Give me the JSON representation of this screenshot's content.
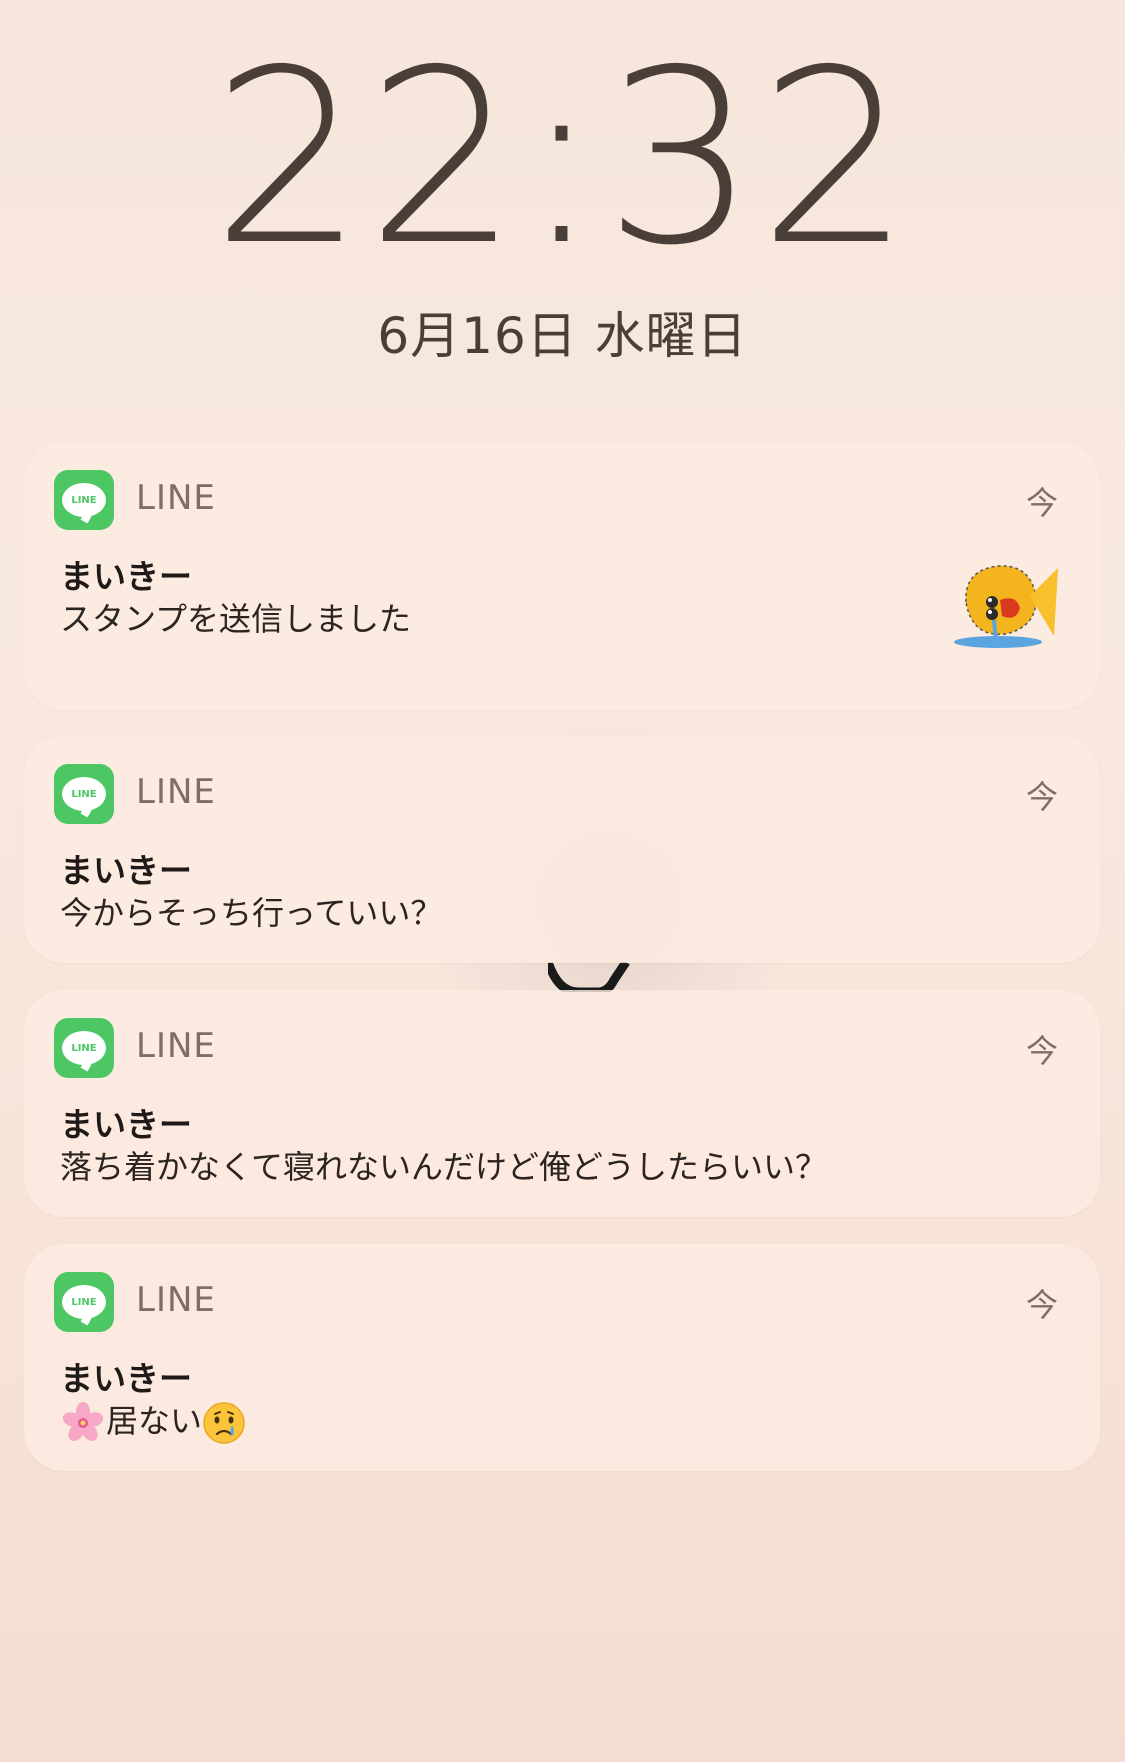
{
  "lockscreen": {
    "time": "22:32",
    "date": "6月16日 水曜日"
  },
  "notifications": [
    {
      "app": "LINE",
      "app_icon_text": "LINE",
      "time": "今",
      "sender": "まいきー",
      "message": "スタンプを送信しました",
      "has_sticker": true
    },
    {
      "app": "LINE",
      "app_icon_text": "LINE",
      "time": "今",
      "sender": "まいきー",
      "message": "今からそっち行っていい？"
    },
    {
      "app": "LINE",
      "app_icon_text": "LINE",
      "time": "今",
      "sender": "まいきー",
      "message": "落ち着かなくて寝れないんだけど俺どうしたらいい？"
    },
    {
      "app": "LINE",
      "app_icon_text": "LINE",
      "time": "今",
      "sender": "まいきー",
      "message_prefix_icon": "cherry-blossom-emoji",
      "message": "居ない",
      "message_suffix_icon": "crying-face-emoji"
    }
  ],
  "colors": {
    "line_green": "#4cc764",
    "text_primary": "#1f1a17",
    "text_secondary": "#7d6e66",
    "clock": "#4a3f38"
  }
}
